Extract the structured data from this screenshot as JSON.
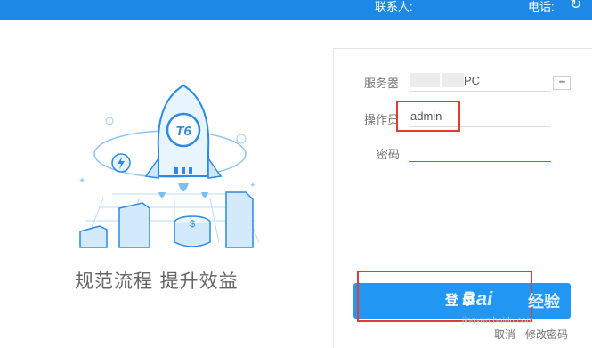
{
  "header": {
    "contact_label": "联系人:",
    "phone_label": "电话:",
    "refresh_icon": "refresh-icon"
  },
  "illustration": {
    "badge_text": "T6",
    "coin_symbol": "$",
    "slogan": "规范流程  提升效益"
  },
  "form": {
    "server_label": "服务器",
    "server_value_partial": "PC",
    "operator_label": "操作员",
    "operator_value": "admin",
    "password_label": "密码",
    "password_value": ""
  },
  "actions": {
    "login_label": "登录",
    "cancel_label": "取消",
    "change_password_label": "修改密码"
  },
  "watermark": {
    "brand": "Bai",
    "brand_suffix": "经验",
    "site": "jingyan.baidu.com"
  },
  "colors": {
    "topbar": "#1e88e5",
    "login_button": "#2196f3",
    "highlight_box": "#e23b32"
  }
}
